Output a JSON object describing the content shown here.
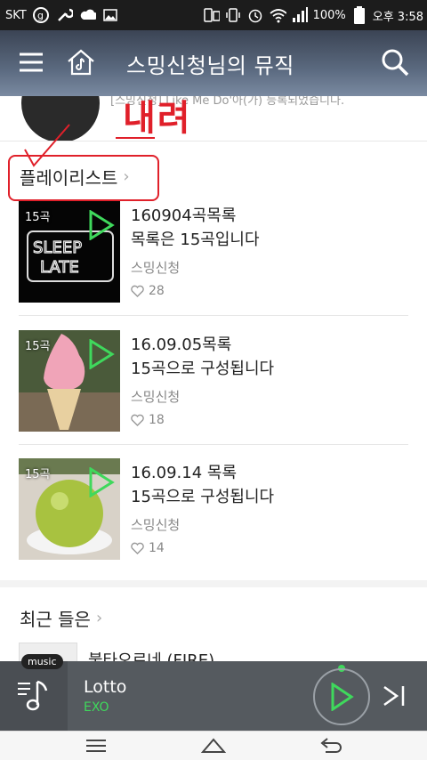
{
  "status_bar": {
    "carrier": "SKT",
    "battery": "100%",
    "time": "오후 3:58"
  },
  "header": {
    "title": "스밍신청님의 뮤직"
  },
  "profile": {
    "notice": "[스밍신청] Like Me Do'아(가) 등록되었습니다."
  },
  "annotation": {
    "text": "내려"
  },
  "playlists": {
    "section_title": "플레이리스트",
    "items": [
      {
        "count": "15곡",
        "title": "160904곡목록",
        "subtitle": "목록은 15곡입니다",
        "owner": "스밍신청",
        "likes": "28"
      },
      {
        "count": "15곡",
        "title": "16.09.05목록",
        "subtitle": "15곡으로 구성됩니다",
        "owner": "스밍신청",
        "likes": "18"
      },
      {
        "count": "15곡",
        "title": "16.09.14 목록",
        "subtitle": "15곡으로 구성됩니다",
        "owner": "스밍신청",
        "likes": "14"
      }
    ]
  },
  "recent": {
    "section_title": "최근 들은",
    "first_item": "불타오르네 (FIRE)"
  },
  "player": {
    "badge": "music",
    "song": "Lotto",
    "artist": "EXO"
  },
  "colors": {
    "accent_green": "#3fd85c",
    "annotation_red": "#e0202a"
  }
}
